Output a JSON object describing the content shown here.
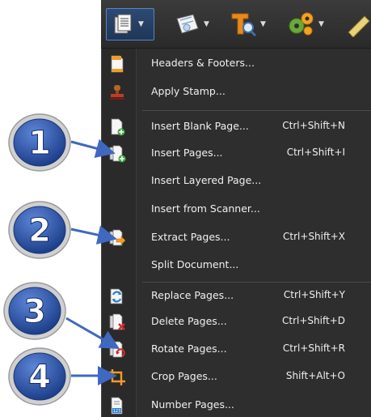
{
  "toolbar": {
    "buttons": [
      {
        "icon": "pages-icon",
        "active": true
      },
      {
        "icon": "certificate-icon"
      },
      {
        "icon": "text-search-icon"
      },
      {
        "icon": "gears-icon"
      },
      {
        "icon": "pen-icon"
      }
    ]
  },
  "menu": {
    "items": [
      {
        "label": "Headers & Footers...",
        "shortcut": "",
        "icon": "header-footer-icon"
      },
      {
        "label": "Apply Stamp...",
        "shortcut": "",
        "icon": "stamp-icon"
      },
      {
        "label": "Insert Blank Page...",
        "shortcut": "Ctrl+Shift+N",
        "icon": "insert-blank-page-icon"
      },
      {
        "label": "Insert Pages...",
        "shortcut": "Ctrl+Shift+I",
        "icon": "insert-pages-icon"
      },
      {
        "label": "Insert Layered Page...",
        "shortcut": "",
        "icon": ""
      },
      {
        "label": "Insert from Scanner...",
        "shortcut": "",
        "icon": ""
      },
      {
        "label": "Extract Pages...",
        "shortcut": "Ctrl+Shift+X",
        "icon": "extract-pages-icon"
      },
      {
        "label": "Split Document...",
        "shortcut": "",
        "icon": ""
      },
      {
        "label": "Replace Pages...",
        "shortcut": "Ctrl+Shift+Y",
        "icon": "replace-pages-icon"
      },
      {
        "label": "Delete Pages...",
        "shortcut": "Ctrl+Shift+D",
        "icon": "delete-pages-icon"
      },
      {
        "label": "Rotate Pages...",
        "shortcut": "Ctrl+Shift+R",
        "icon": "rotate-pages-icon"
      },
      {
        "label": "Crop Pages...",
        "shortcut": "Shift+Alt+O",
        "icon": "crop-pages-icon"
      },
      {
        "label": "Number Pages...",
        "shortcut": "",
        "icon": "number-pages-icon"
      }
    ]
  },
  "callouts": [
    "1",
    "2",
    "3",
    "4"
  ],
  "colors": {
    "menu_bg": "#2e2e2e",
    "menu_text": "#f0f0f0",
    "callout_blue": "#2f56a8",
    "arrow_blue": "#3f68c0"
  }
}
